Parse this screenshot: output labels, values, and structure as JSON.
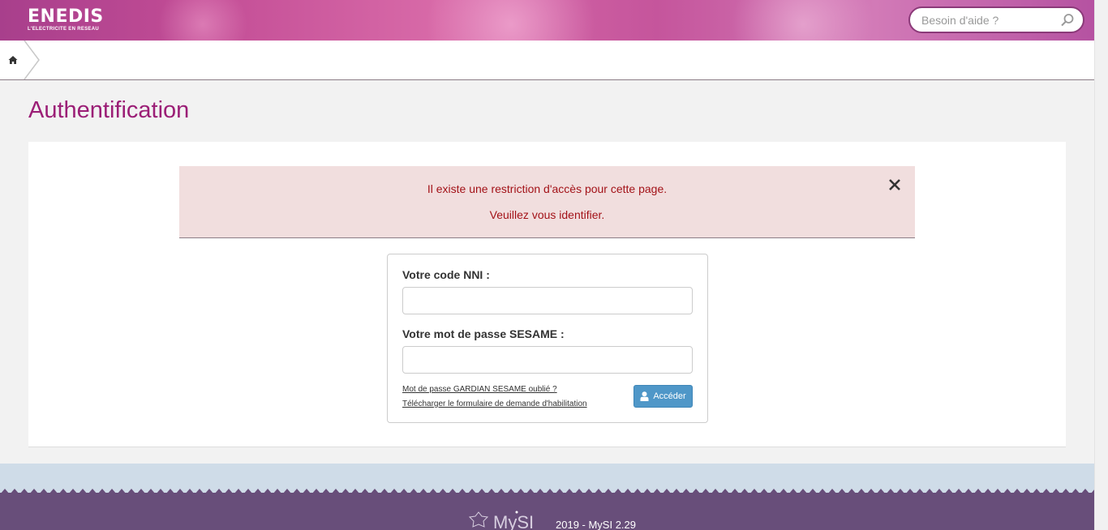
{
  "header": {
    "logo_brand": "ENEDIS",
    "logo_tagline": "L'ELECTRICITE EN RESEAU",
    "help_search_placeholder": "Besoin d'aide ?"
  },
  "breadcrumb": {
    "home_icon": "home-icon"
  },
  "page": {
    "title": "Authentification"
  },
  "alert": {
    "line1": "Il existe une restriction d'accès pour cette page.",
    "line2": "Veuillez vous identifier.",
    "close_icon": "close-icon",
    "color": "#a31218",
    "background": "#f1dede"
  },
  "login": {
    "nni_label": "Votre code NNI :",
    "nni_value": "",
    "password_label": "Votre mot de passe SESAME :",
    "password_value": "",
    "forgot_link": "Mot de passe GARDIAN SESAME oublié ?",
    "download_link": "Télécharger le formulaire de demande d'habilitation",
    "submit_label": "Accéder",
    "submit_icon": "user-icon",
    "button_color": "#4f97c8"
  },
  "footer": {
    "logo_text": "MySI",
    "version": "2019 - MySI 2.29",
    "background": "#684e7a"
  },
  "theme": {
    "accent": "#9b1e76"
  }
}
